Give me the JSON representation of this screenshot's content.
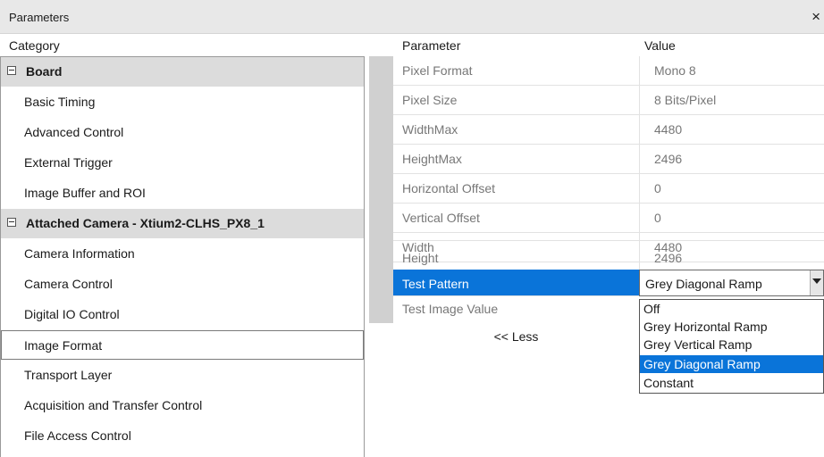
{
  "window": {
    "title": "Parameters",
    "close_glyph": "×"
  },
  "columns": {
    "category": "Category",
    "parameter": "Parameter",
    "value": "Value"
  },
  "categories": [
    {
      "label": "Board",
      "kind": "group",
      "expander": "minus-box-icon"
    },
    {
      "label": "Basic Timing",
      "kind": "item"
    },
    {
      "label": "Advanced Control",
      "kind": "item"
    },
    {
      "label": "External Trigger",
      "kind": "item"
    },
    {
      "label": "Image Buffer and ROI",
      "kind": "item"
    },
    {
      "label": "Attached Camera - Xtium2-CLHS_PX8_1",
      "kind": "group",
      "expander": "minus-box-icon"
    },
    {
      "label": "Camera Information",
      "kind": "item"
    },
    {
      "label": "Camera Control",
      "kind": "item"
    },
    {
      "label": "Digital IO Control",
      "kind": "item"
    },
    {
      "label": "Image Format",
      "kind": "item",
      "selected": true
    },
    {
      "label": "Transport Layer",
      "kind": "item"
    },
    {
      "label": "Acquisition and Transfer Control",
      "kind": "item"
    },
    {
      "label": "File Access Control",
      "kind": "item"
    }
  ],
  "parameters": [
    {
      "name": "Pixel Format",
      "value": "Mono 8"
    },
    {
      "name": "Pixel Size",
      "value": "8 Bits/Pixel"
    },
    {
      "name": "WidthMax",
      "value": "4480"
    },
    {
      "name": "HeightMax",
      "value": "2496"
    },
    {
      "name": "Horizontal Offset",
      "value": "0"
    },
    {
      "name": "Vertical Offset",
      "value": "0"
    },
    {
      "name": "Width",
      "value": "4480"
    },
    {
      "name": "Height",
      "value": "2496"
    },
    {
      "name": "Test Pattern",
      "value": "Grey Diagonal Ramp",
      "active": true
    },
    {
      "name": "Test Image Value",
      "value": ""
    }
  ],
  "less_button": "<< Less",
  "test_pattern_dropdown": {
    "selected": "Grey Diagonal Ramp",
    "options": [
      "Off",
      "Grey Horizontal Ramp",
      "Grey Vertical Ramp",
      "Grey Diagonal Ramp",
      "Constant"
    ],
    "highlighted_index": 3
  },
  "colors": {
    "selection": "#0a74d9",
    "group_background": "#dcdcdc",
    "gutter": "#d0d0d0",
    "disabled_text": "#777777"
  }
}
